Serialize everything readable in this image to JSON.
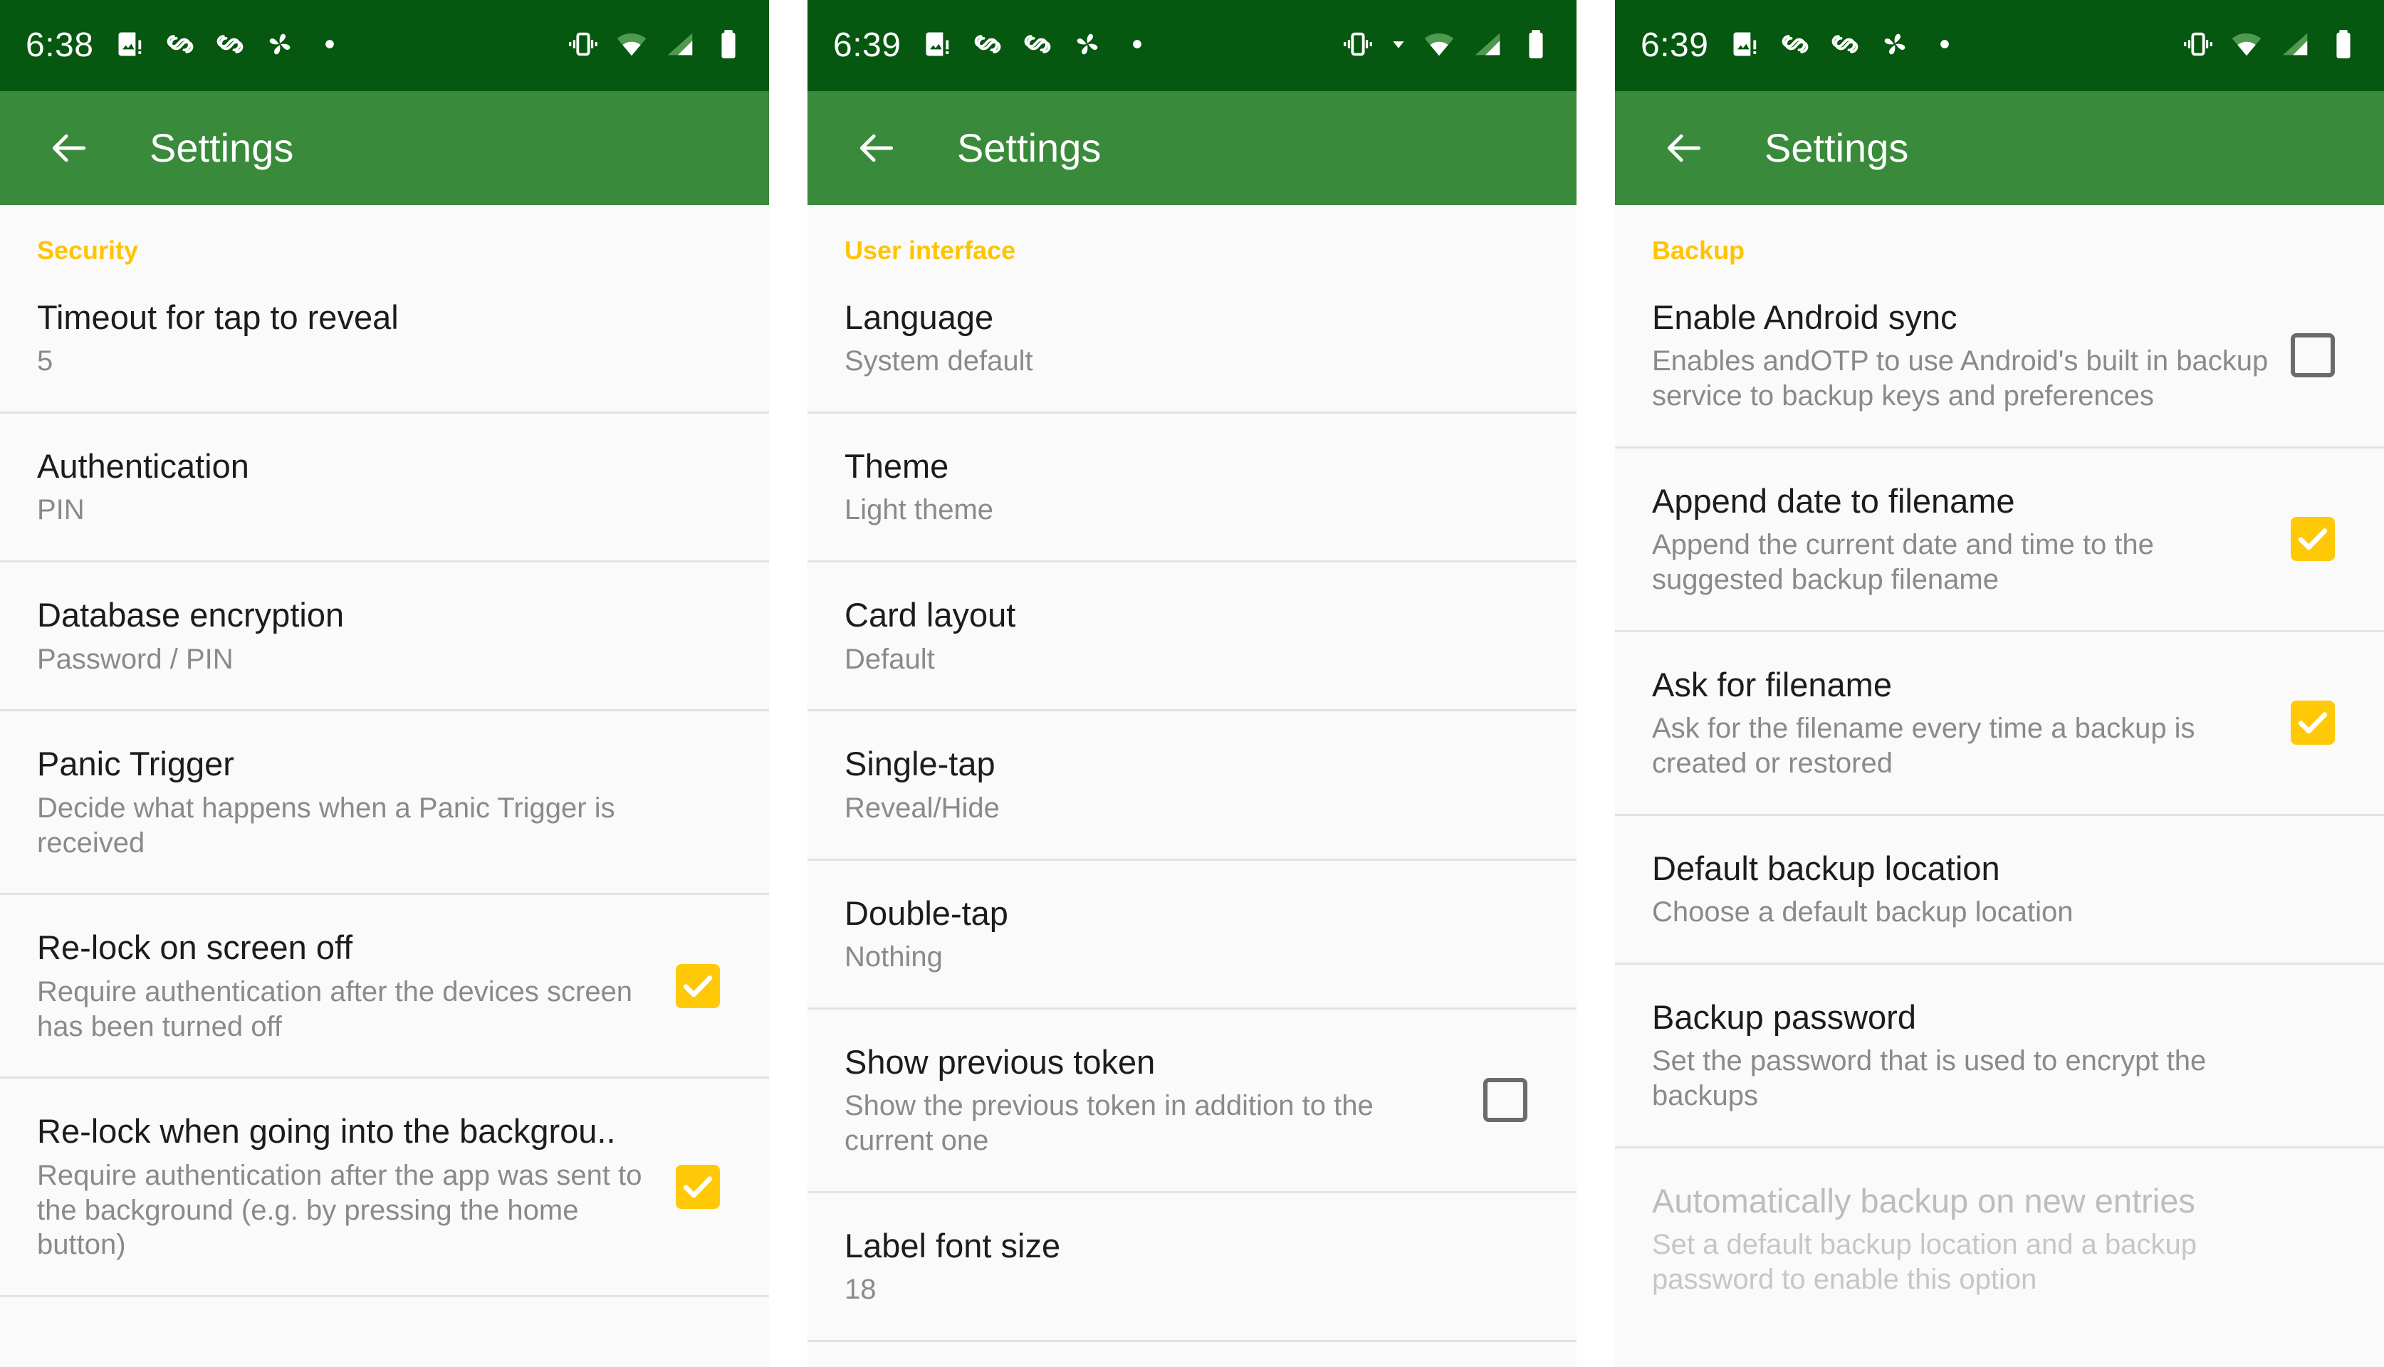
{
  "colors": {
    "statusbar": "#06570f",
    "appbar": "#398a3a",
    "category_accent": "#ffc400",
    "checkbox_on": "#ffc907",
    "background": "#fafafa",
    "title_text": "#1c1c1c",
    "summary_text": "#8a8a8a",
    "disabled_text": "#bdbdbd"
  },
  "screens": [
    {
      "status": {
        "clock": "6:38",
        "left_icons": [
          "image-alert-icon",
          "link-icon",
          "link-icon",
          "pinwheel-icon",
          "dot-icon"
        ],
        "right_icons": [
          "vibrate-icon",
          "wifi-icon",
          "signal-icon",
          "battery-icon"
        ]
      },
      "appbar": {
        "back": "back-arrow",
        "title": "Settings"
      },
      "category": "Security",
      "items": [
        {
          "title": "Timeout for tap to reveal",
          "summary": "5",
          "checkbox": null
        },
        {
          "title": "Authentication",
          "summary": "PIN",
          "checkbox": null
        },
        {
          "title": "Database encryption",
          "summary": "Password / PIN",
          "checkbox": null
        },
        {
          "title": "Panic Trigger",
          "summary": "Decide what happens when a Panic Trigger is received",
          "checkbox": null
        },
        {
          "title": "Re-lock on screen off",
          "summary": "Require authentication after the devices screen has been turned off",
          "checkbox": "checked"
        },
        {
          "title": "Re-lock when going into the backgrou..",
          "summary": "Require authentication after the app was sent to the background (e.g. by pressing the home button)",
          "checkbox": "checked"
        }
      ]
    },
    {
      "status": {
        "clock": "6:39",
        "left_icons": [
          "image-alert-icon",
          "link-icon",
          "link-icon",
          "pinwheel-icon",
          "dot-icon"
        ],
        "right_icons": [
          "vibrate-icon",
          "wifi-icon",
          "signal-icon",
          "battery-icon"
        ]
      },
      "appbar": {
        "back": "back-arrow",
        "title": "Settings"
      },
      "category": "User interface",
      "items": [
        {
          "title": "Language",
          "summary": "System default",
          "checkbox": null
        },
        {
          "title": "Theme",
          "summary": "Light theme",
          "checkbox": null
        },
        {
          "title": "Card layout",
          "summary": "Default",
          "checkbox": null
        },
        {
          "title": "Single-tap",
          "summary": "Reveal/Hide",
          "checkbox": null
        },
        {
          "title": "Double-tap",
          "summary": "Nothing",
          "checkbox": null
        },
        {
          "title": "Show previous token",
          "summary": "Show the previous token in addition to the current one",
          "checkbox": "unchecked"
        },
        {
          "title": "Label font size",
          "summary": "18",
          "checkbox": null
        }
      ]
    },
    {
      "status": {
        "clock": "6:39",
        "left_icons": [
          "image-alert-icon",
          "link-icon",
          "link-icon",
          "pinwheel-icon",
          "dot-icon"
        ],
        "right_icons": [
          "vibrate-icon",
          "wifi-icon",
          "signal-icon",
          "battery-icon"
        ]
      },
      "appbar": {
        "back": "back-arrow",
        "title": "Settings"
      },
      "category": "Backup",
      "items": [
        {
          "title": "Enable Android sync",
          "summary": "Enables andOTP to use Android's built in backup service to backup keys and preferences",
          "checkbox": "unchecked"
        },
        {
          "title": "Append date to filename",
          "summary": "Append the current date and time to the suggested backup filename",
          "checkbox": "checked"
        },
        {
          "title": "Ask for filename",
          "summary": "Ask for the filename every time a backup is created or restored",
          "checkbox": "checked"
        },
        {
          "title": "Default backup location",
          "summary": "Choose a default backup location",
          "checkbox": null
        },
        {
          "title": "Backup password",
          "summary": "Set the password that is used to encrypt the backups",
          "checkbox": null
        },
        {
          "title": "Automatically backup on new entries",
          "summary": "Set a default backup location and a backup password to enable this option",
          "checkbox": null,
          "disabled": true
        }
      ]
    }
  ]
}
